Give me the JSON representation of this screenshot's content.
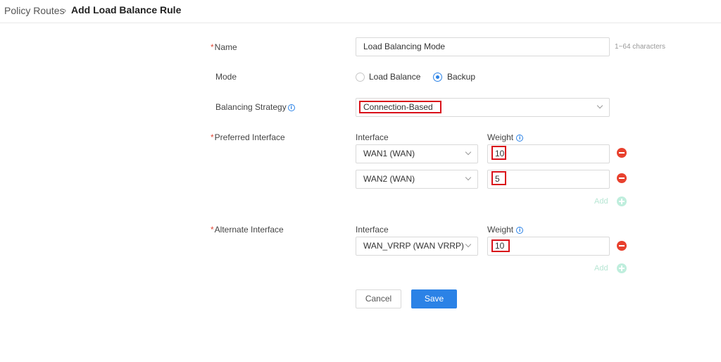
{
  "breadcrumb": {
    "root": "Policy Routes",
    "separator": "›",
    "current": "Add Load Balance Rule"
  },
  "form": {
    "name": {
      "required_mark": "*",
      "label": "Name",
      "value": "Load Balancing Mode",
      "hint": "1~64 characters"
    },
    "mode": {
      "label": "Mode",
      "options": [
        "Load Balance",
        "Backup"
      ],
      "selected": "Backup"
    },
    "strategy": {
      "label": "Balancing Strategy",
      "value": "Connection-Based"
    },
    "preferred": {
      "required_mark": "*",
      "label": "Preferred Interface",
      "interface_header": "Interface",
      "weight_header": "Weight",
      "rows": [
        {
          "interface": "WAN1 (WAN)",
          "weight": "10"
        },
        {
          "interface": "WAN2 (WAN)",
          "weight": "5"
        }
      ],
      "add_label": "Add"
    },
    "alternate": {
      "required_mark": "*",
      "label": "Alternate Interface",
      "interface_header": "Interface",
      "weight_header": "Weight",
      "rows": [
        {
          "interface": "WAN_VRRP (WAN VRRP)",
          "weight": "10"
        }
      ],
      "add_label": "Add"
    }
  },
  "actions": {
    "cancel_label": "Cancel",
    "save_label": "Save"
  },
  "colors": {
    "accent": "#2b82e6",
    "danger": "#e8412e",
    "required": "#e04b3a",
    "highlight": "#d9111a",
    "add_disabled": "#bfeedd"
  },
  "icons": {
    "info": "info-circle-icon",
    "dropdown": "chevron-down-icon",
    "remove": "minus-circle-icon",
    "add": "plus-circle-icon"
  }
}
